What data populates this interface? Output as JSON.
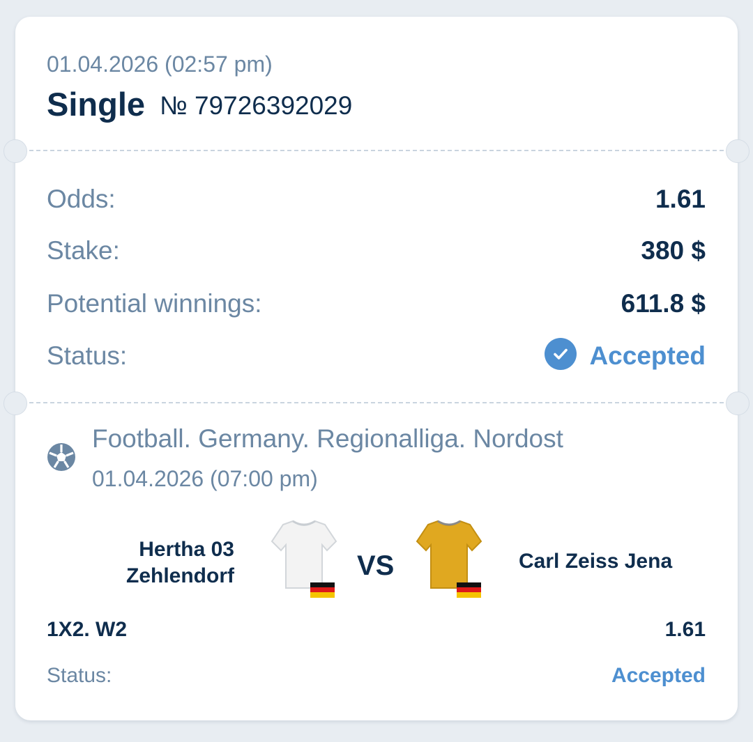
{
  "bet": {
    "date": "01.04.2026 (02:57 pm)",
    "type": "Single",
    "number": "№ 79726392029"
  },
  "summary": {
    "odds_label": "Odds:",
    "odds_value": "1.61",
    "stake_label": "Stake:",
    "stake_value": "380 $",
    "winnings_label": "Potential winnings:",
    "winnings_value": "611.8 $",
    "status_label": "Status:",
    "status_value": "Accepted"
  },
  "event": {
    "sport_icon": "football-icon",
    "league": "Football. Germany. Regionalliga. Nordost",
    "date": "01.04.2026 (07:00 pm)",
    "home_team": "Hertha 03 Zehlendorf",
    "home_team_line1": "Hertha 03",
    "home_team_line2": "Zehlendorf",
    "away_team": "Carl Zeiss Jena",
    "vs": "VS",
    "market": "1X2. W2",
    "market_odds": "1.61",
    "status_label": "Status:",
    "status_value": "Accepted"
  },
  "colors": {
    "accent": "#4d8fd0",
    "text_dark": "#0f2d4d",
    "text_muted": "#6b87a3",
    "home_shirt": "#f2f2f2",
    "away_shirt": "#e0a820"
  }
}
